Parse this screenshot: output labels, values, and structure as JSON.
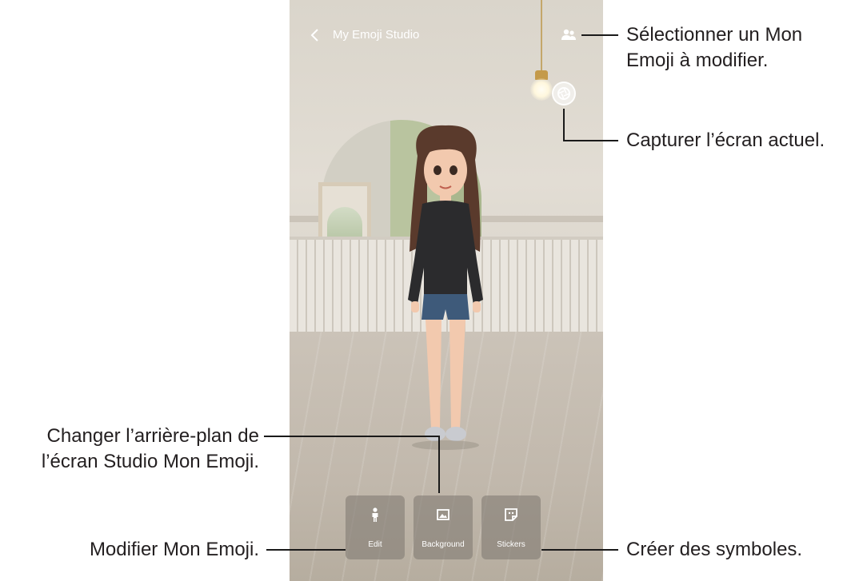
{
  "screen": {
    "title": "My Emoji Studio",
    "back_icon": "chevron-left-icon",
    "select_emoji_icon": "people-icon",
    "capture_icon": "camera-shutter-icon"
  },
  "toolbar": {
    "edit_label": "Edit",
    "background_label": "Background",
    "stickers_label": "Stickers"
  },
  "callouts": {
    "select_line1": "Sélectionner un Mon",
    "select_line2": "Emoji à modifier.",
    "capture": "Capturer l’écran actuel.",
    "background_line1": "Changer l’arrière-plan de",
    "background_line2": "l’écran Studio Mon Emoji.",
    "edit": "Modifier Mon Emoji.",
    "stickers": "Créer des symboles."
  },
  "colors": {
    "leader_line": "#1a1a1a",
    "button_bg": "#827c74",
    "callout_text": "#231f20"
  }
}
